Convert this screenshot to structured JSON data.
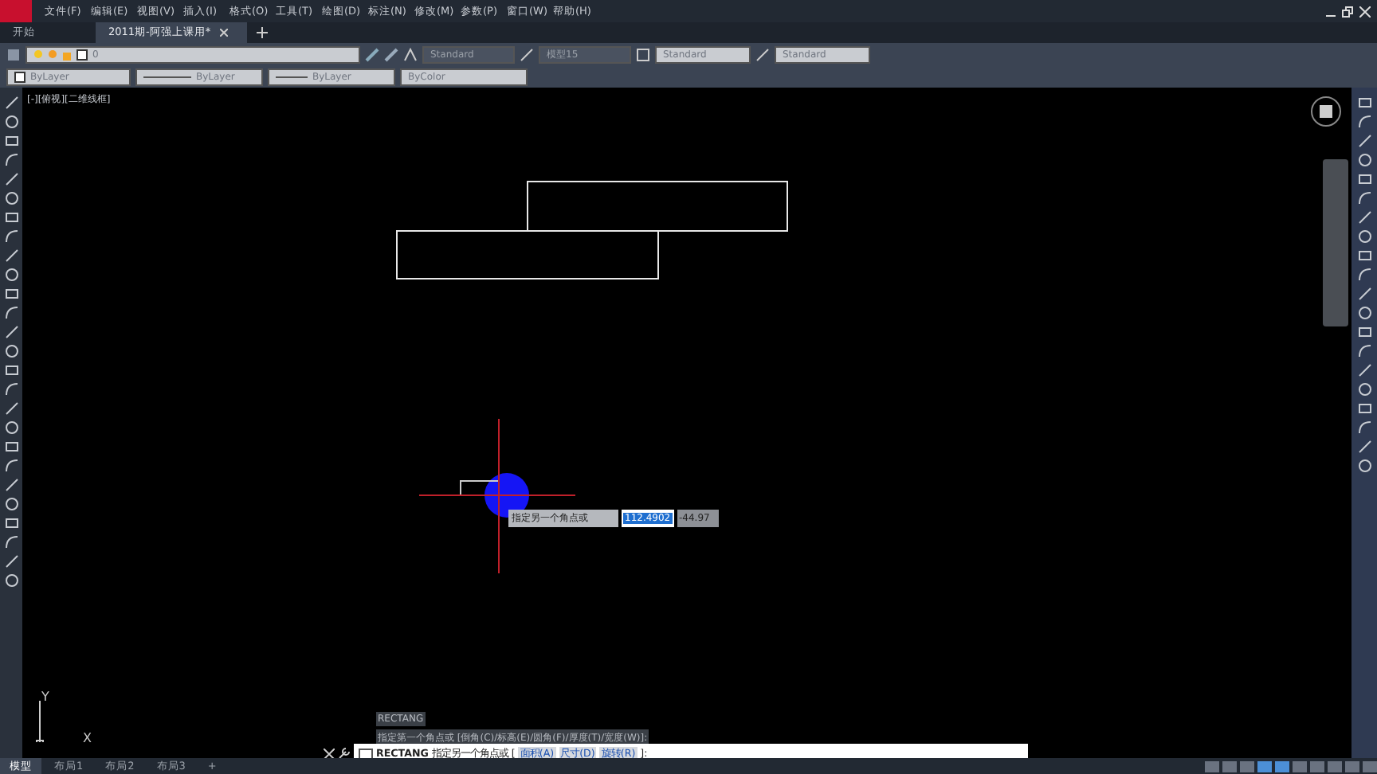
{
  "menu": [
    "文件(F)",
    "编辑(E)",
    "视图(V)",
    "插入(I)",
    "格式(O)",
    "工具(T)",
    "绘图(D)",
    "标注(N)",
    "修改(M)",
    "参数(P)",
    "窗口(W)",
    "帮助(H)"
  ],
  "tabs": [
    {
      "label": "开始",
      "selected": false
    },
    {
      "label": "2011期-阿强上课用*",
      "selected": true
    }
  ],
  "toolbar": {
    "layer": "0",
    "text_style": "Standard",
    "dim_style": "模型15",
    "table_style": "Standard",
    "mleader_style": "Standard"
  },
  "properties": [
    "ByLayer",
    "ByLayer",
    "ByLayer",
    "ByColor"
  ],
  "viewport_label": "[-][俯视][二维线框]",
  "dynamic_input": {
    "prompt": "指定另一个角点或",
    "x_value": "112.4902",
    "y_value": "-44.97"
  },
  "command_history": [
    "RECTANG",
    "指定第一个角点或 [倒角(C)/标高(E)/圆角(F)/厚度(T)/宽度(W)]:"
  ],
  "command_line": {
    "command": "RECTANG",
    "prompt": "指定另一个角点或 [",
    "options": [
      "面积(A)",
      "尺寸(D)",
      "旋转(R)"
    ],
    "end": "]:"
  },
  "ucs": {
    "x": "X",
    "y": "Y"
  },
  "layout_tabs": [
    {
      "label": "模型",
      "selected": true
    },
    {
      "label": "布局1",
      "selected": false
    },
    {
      "label": "布局2",
      "selected": false
    },
    {
      "label": "布局3",
      "selected": false
    }
  ],
  "add_tab": "+"
}
